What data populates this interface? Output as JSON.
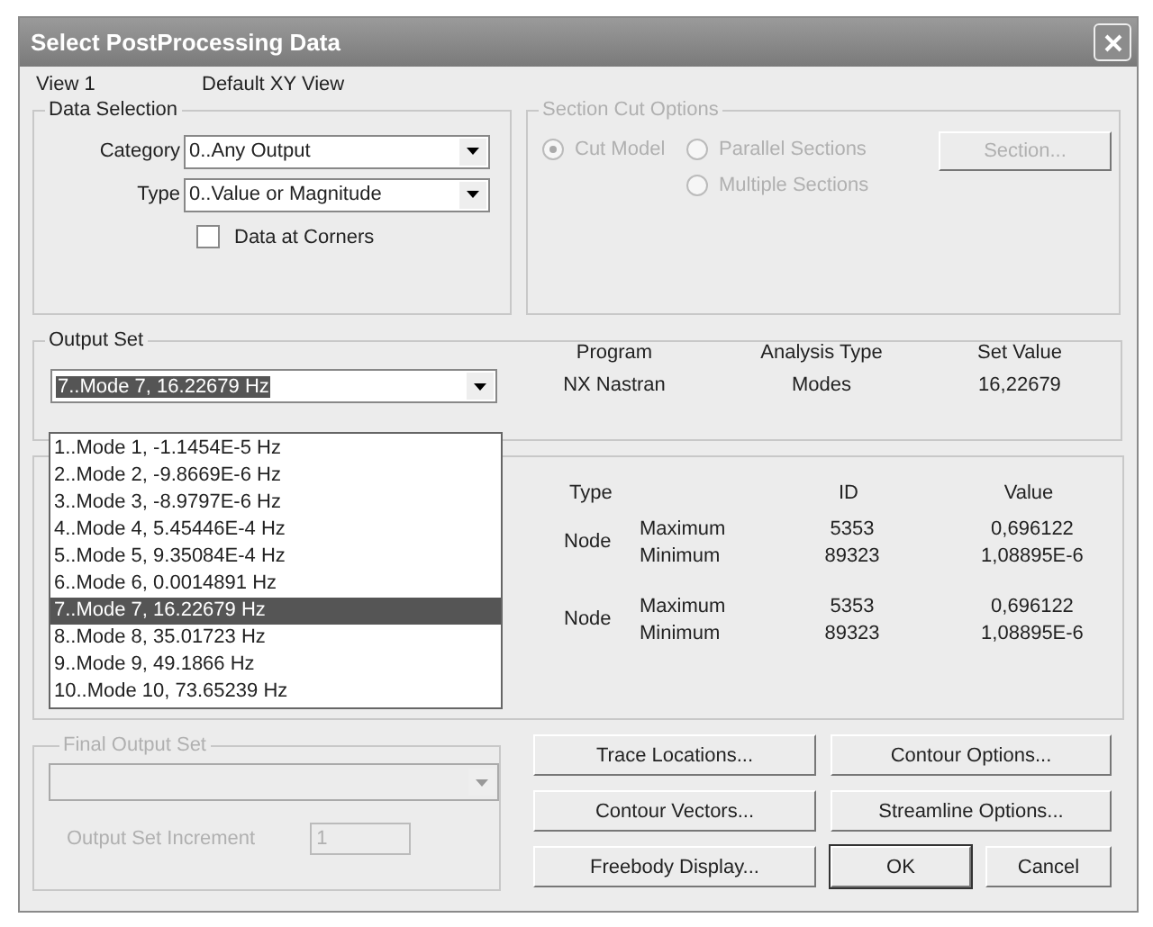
{
  "window": {
    "title": "Select PostProcessing Data"
  },
  "view": {
    "label": "View 1",
    "name": "Default XY View"
  },
  "data_selection": {
    "title": "Data Selection",
    "category": {
      "label": "Category",
      "value": "0..Any Output"
    },
    "type": {
      "label": "Type",
      "value": "0..Value or Magnitude"
    },
    "corners": {
      "label": "Data at Corners",
      "checked": false
    }
  },
  "section_cut": {
    "title": "Section Cut Options",
    "disabled": true,
    "button": "Section...",
    "options": [
      {
        "label": "Cut Model",
        "selected": true
      },
      {
        "label": "Parallel Sections",
        "selected": false
      },
      {
        "label": "Multiple Sections",
        "selected": false
      }
    ]
  },
  "output_set": {
    "title": "Output Set",
    "value": "7..Mode 7, 16.22679 Hz",
    "columns": [
      "Program",
      "Analysis Type",
      "Set Value"
    ],
    "values": [
      "NX Nastran",
      "Modes",
      "16,22679"
    ],
    "list": [
      {
        "label": "1..Mode 1, -1.1454E-5 Hz",
        "selected": false
      },
      {
        "label": "2..Mode 2, -9.8669E-6 Hz",
        "selected": false
      },
      {
        "label": "3..Mode 3, -8.9797E-6 Hz",
        "selected": false
      },
      {
        "label": "4..Mode 4, 5.45446E-4 Hz",
        "selected": false
      },
      {
        "label": "5..Mode 5, 9.35084E-4 Hz",
        "selected": false
      },
      {
        "label": "6..Mode 6, 0.0014891 Hz",
        "selected": false
      },
      {
        "label": "7..Mode 7, 16.22679 Hz",
        "selected": true
      },
      {
        "label": "8..Mode 8, 35.01723 Hz",
        "selected": false
      },
      {
        "label": "9..Mode 9, 49.1866 Hz",
        "selected": false
      },
      {
        "label": "10..Mode 10, 73.65239 Hz",
        "selected": false
      }
    ]
  },
  "output_vectors": {
    "columns": [
      "Type",
      "ID",
      "Value"
    ],
    "groups": [
      {
        "type": "Node",
        "rows": [
          {
            "label": "Maximum",
            "id": "5353",
            "value": "0,696122"
          },
          {
            "label": "Minimum",
            "id": "89323",
            "value": "1,08895E-6"
          }
        ]
      },
      {
        "type": "Node",
        "rows": [
          {
            "label": "Maximum",
            "id": "5353",
            "value": "0,696122"
          },
          {
            "label": "Minimum",
            "id": "89323",
            "value": "1,08895E-6"
          }
        ]
      }
    ]
  },
  "final_output_set": {
    "title": "Final Output Set",
    "disabled": true,
    "increment_label": "Output Set Increment",
    "increment": "1"
  },
  "buttons": [
    {
      "label": "Trace Locations...",
      "kind": "left",
      "default": false
    },
    {
      "label": "Contour Options...",
      "kind": "right",
      "default": false
    },
    {
      "label": "Contour Vectors...",
      "kind": "left",
      "default": false
    },
    {
      "label": "Streamline Options...",
      "kind": "right",
      "default": false
    },
    {
      "label": "Freebody Display...",
      "kind": "left",
      "default": false
    },
    {
      "label": "OK",
      "kind": "small",
      "default": true
    },
    {
      "label": "Cancel",
      "kind": "small",
      "default": false
    }
  ]
}
